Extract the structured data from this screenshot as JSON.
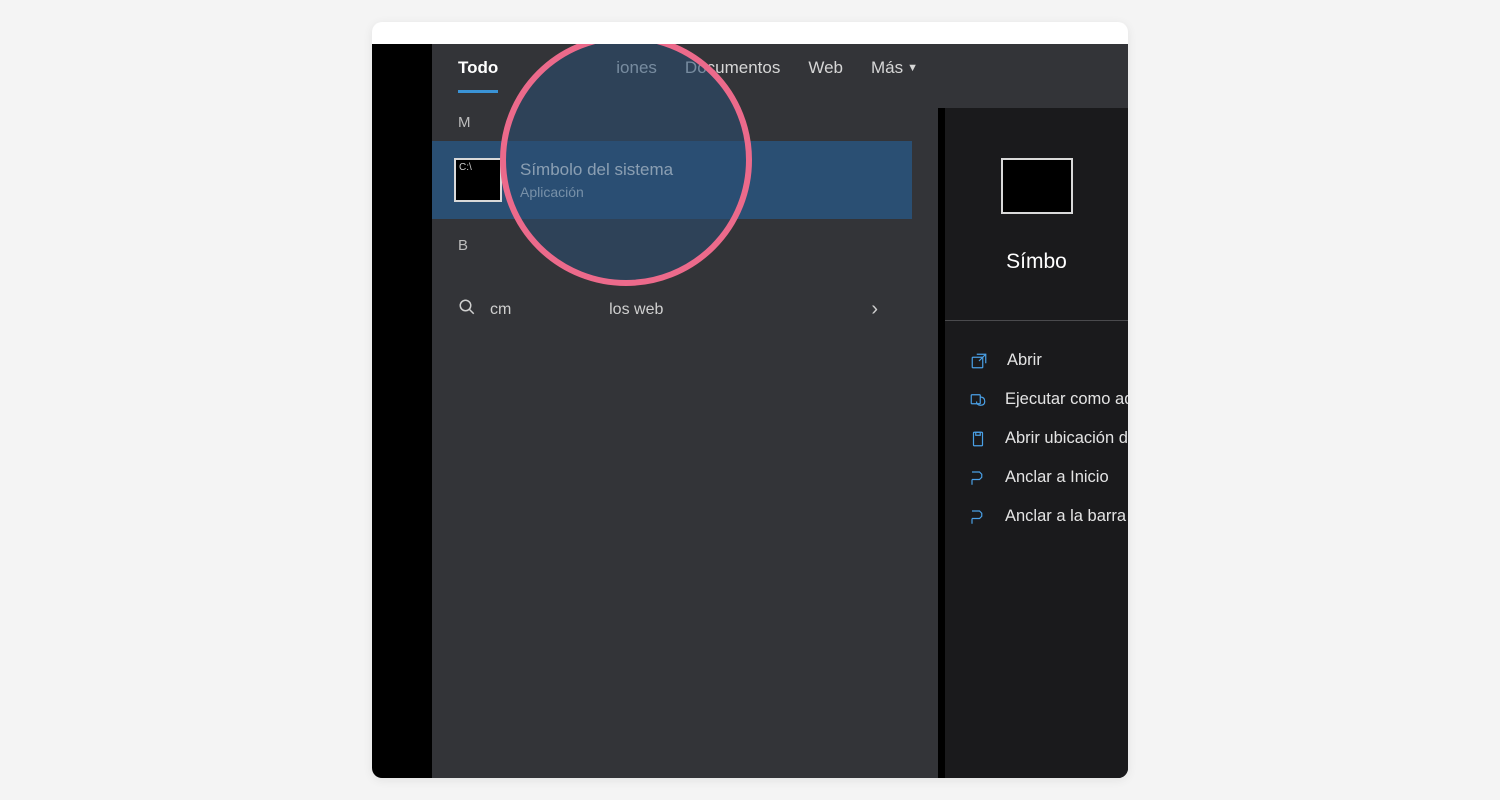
{
  "tabs": {
    "all": "Todo",
    "apps_fragment": "iones",
    "documents": "Documentos",
    "web": "Web",
    "more": "Más"
  },
  "sections": {
    "best_match_prefix": "M",
    "search_web_prefix": "B"
  },
  "best_match": {
    "title": "Símbolo del sistema",
    "subtitle": "Aplicación"
  },
  "web_search": {
    "query_prefix": "cm",
    "label_suffix": "los web"
  },
  "preview": {
    "title_fragment": "Símbo"
  },
  "actions": {
    "open": "Abrir",
    "run_admin": "Ejecutar como admin",
    "open_location": "Abrir ubicación de ar",
    "pin_start": "Anclar a Inicio",
    "pin_taskbar": "Anclar a la barra de t"
  }
}
